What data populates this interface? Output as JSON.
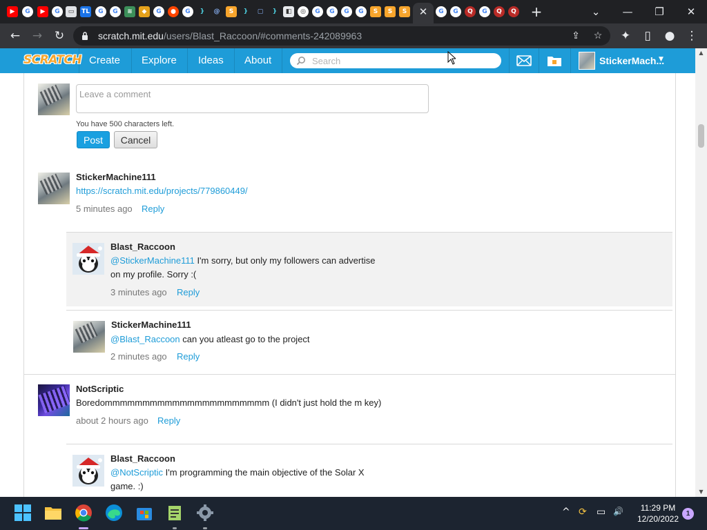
{
  "browser": {
    "tab_close": "✕",
    "new_tab": "+",
    "url_host": "scratch.mit.edu",
    "url_path": "/users/Blast_Raccoon/#comments-242089963",
    "window_min": "—",
    "window_max": "❐",
    "window_close": "✕",
    "dropdown": "⌄",
    "nav_back": "←",
    "nav_forward": "→",
    "nav_reload": "↻",
    "share_icon": "⇪",
    "star_icon": "☆",
    "ext_icon": "✦",
    "sidepanel_icon": "▯",
    "profile_icon": "●",
    "menu_icon": "⋮"
  },
  "nav": {
    "logo": "SCRATCH",
    "links": [
      "Create",
      "Explore",
      "Ideas",
      "About"
    ],
    "search_placeholder": "Search",
    "account_name": "StickerMach...",
    "caret": "▼"
  },
  "compose": {
    "placeholder": "Leave a comment",
    "chars_left": "You have 500 characters left.",
    "post_label": "Post",
    "cancel_label": "Cancel"
  },
  "comments": [
    {
      "user": "StickerMachine111",
      "link": "https://scratch.mit.edu/projects/779860449/",
      "time": "5 minutes ago",
      "reply": "Reply"
    },
    {
      "user": "Blast_Raccoon",
      "mention": "@StickerMachine111",
      "text_line1": " I'm sorry, but only my followers can advertise",
      "text_line2": "on my profile. Sorry :(",
      "time": "3 minutes ago",
      "reply": "Reply"
    },
    {
      "user": "StickerMachine111",
      "mention": "@Blast_Raccoon",
      "text": " can you atleast go to the project",
      "time": "2 minutes ago",
      "reply": "Reply"
    },
    {
      "user": "NotScriptic",
      "text": "Boredommmmmmmmmmmmmmmmmmmmmm (I didn't just hold the m key)",
      "time": "about 2 hours ago",
      "reply": "Reply"
    },
    {
      "user": "Blast_Raccoon",
      "mention": "@NotScriptic",
      "text_line1": " I'm programming the main objective of the Solar X",
      "text_line2": "game. :)"
    }
  ],
  "taskbar": {
    "time": "11:29 PM",
    "date": "12/20/2022",
    "notifications": "1",
    "chevron_up": "^",
    "sync_icon": "⟳",
    "network_icon": "▭",
    "volume_icon": "🔊"
  },
  "colors": {
    "scratch_blue": "#1e9cd8",
    "chrome_dark": "#202124",
    "taskbar": "#1c2430"
  }
}
